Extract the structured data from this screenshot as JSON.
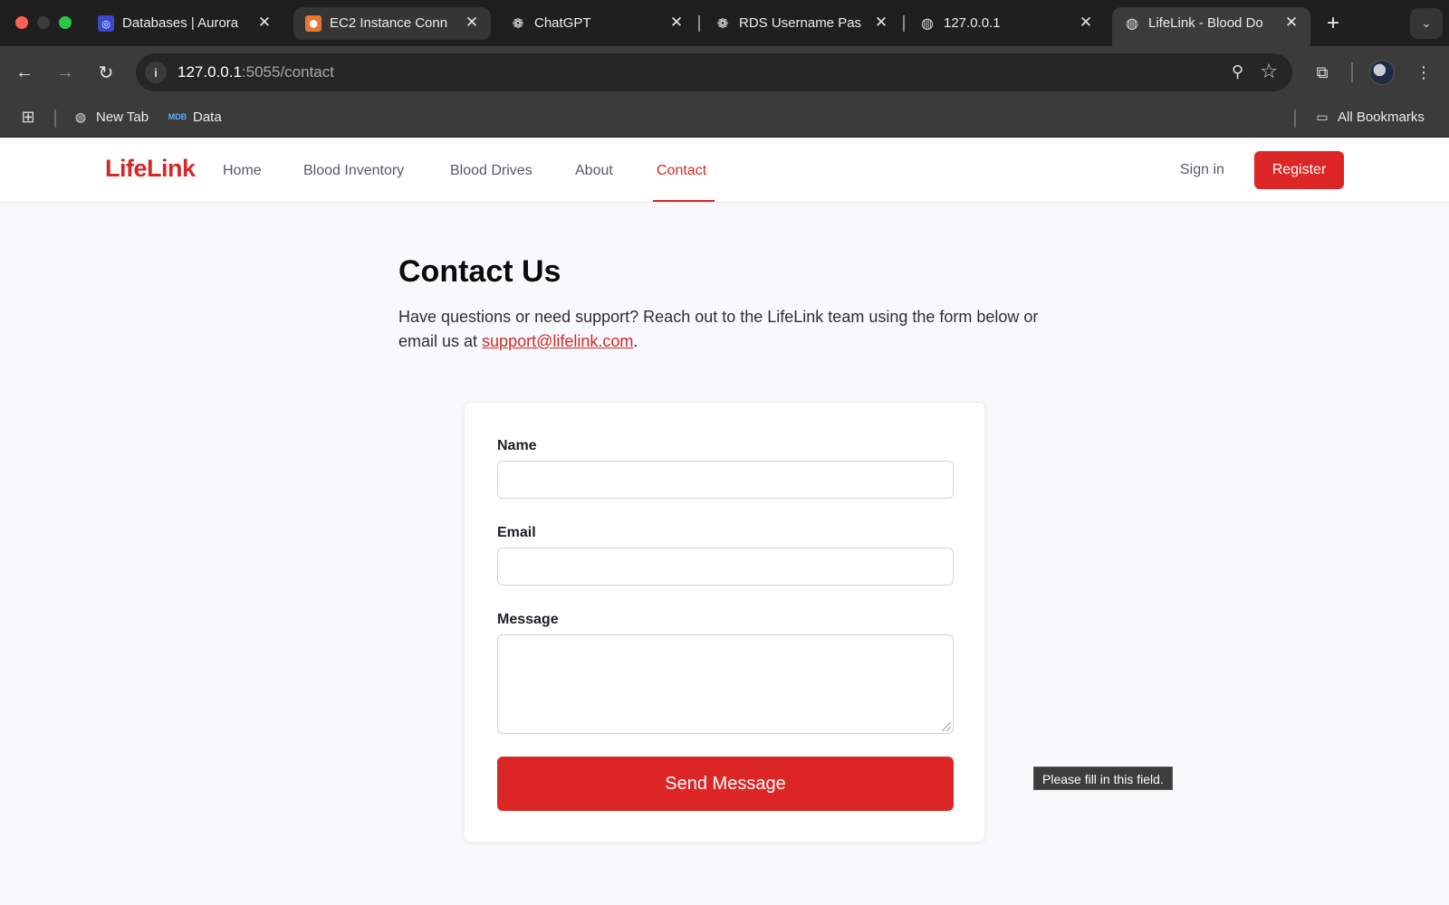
{
  "browser": {
    "tabs": [
      {
        "title": "Databases | Aurora",
        "icon": "aurora-rds-icon"
      },
      {
        "title": "EC2 Instance Conn",
        "icon": "ec2-icon"
      },
      {
        "title": "ChatGPT",
        "icon": "openai-icon"
      },
      {
        "title": "RDS Username Pas",
        "icon": "openai-icon"
      },
      {
        "title": "127.0.0.1",
        "icon": "globe-icon"
      },
      {
        "title": "LifeLink - Blood Do",
        "icon": "globe-icon"
      }
    ],
    "active_tab_index": 5,
    "url_host": "127.0.0.1",
    "url_path": ":5055/contact",
    "bookmarks": [
      {
        "label": "New Tab",
        "icon": "globe-icon"
      },
      {
        "label": "Data",
        "icon": "mdb-icon"
      }
    ],
    "all_bookmarks_label": "All Bookmarks"
  },
  "site": {
    "logo": "LifeLink",
    "nav": [
      "Home",
      "Blood Inventory",
      "Blood Drives",
      "About",
      "Contact"
    ],
    "active_nav": "Contact",
    "sign_in": "Sign in",
    "register": "Register",
    "brand_color": "#dc2626"
  },
  "contact": {
    "title": "Contact Us",
    "intro_before": "Have questions or need support? Reach out to the LifeLink team using the form below or email us at ",
    "email": "support@lifelink.com",
    "intro_after": ".",
    "fields": {
      "name_label": "Name",
      "name_value": "",
      "email_label": "Email",
      "email_value": "",
      "message_label": "Message",
      "message_value": ""
    },
    "submit": "Send Message",
    "validation_tooltip": "Please fill in this field."
  }
}
